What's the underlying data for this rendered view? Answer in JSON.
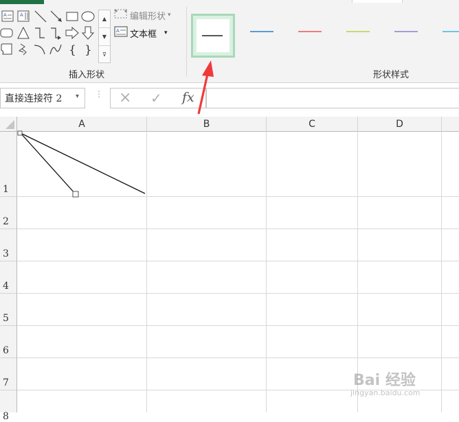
{
  "ribbon": {
    "edit_shape_label": "编辑形状",
    "textbox_label": "文本框",
    "group_insert_shapes": "插入形状",
    "group_shape_styles": "形状样式",
    "style_swatch_colors": [
      "#555555",
      "#5b9bd5",
      "#ed7d7d",
      "#c9d86f",
      "#a99bd5",
      "#6fc3e8"
    ]
  },
  "formula_bar": {
    "name_box_value": "直接连接符 2",
    "cancel_icon": "×",
    "confirm_icon": "✓",
    "fx_label": "fx",
    "formula_value": ""
  },
  "sheet": {
    "columns": [
      "A",
      "B",
      "C",
      "D"
    ],
    "rows": [
      "1",
      "2",
      "3",
      "4",
      "5",
      "6",
      "7",
      "8"
    ]
  },
  "annotation": {
    "arrow_color": "#f03a3a"
  },
  "watermark": {
    "brand": "Bai 经验",
    "url": "jingyan.baidu.com"
  }
}
